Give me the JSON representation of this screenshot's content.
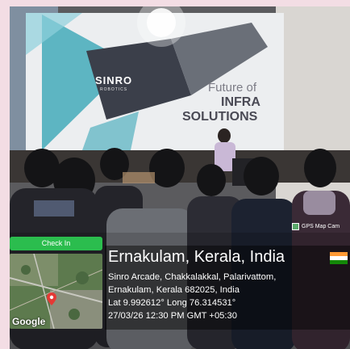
{
  "slide": {
    "brand": "SINRO",
    "brand_sub": "ROBOTICS",
    "line1": "Future of",
    "line2": "INFRA",
    "line3": "SOLUTIONS"
  },
  "gps_stamp": {
    "app_name": "GPS Map Cam",
    "check_in": "Check In",
    "map_logo": "Google",
    "city": "Ernakulam, Kerala, India",
    "address_line1": "Sinro Arcade, Chakkalakkal, Palarivattom,",
    "address_line2": "Ernakulam, Kerala 682025, India",
    "coordinates": "Lat 9.992612° Long 76.314531°",
    "datetime": "27/03/26 12:30 PM GMT +05:30",
    "flag_colors": [
      "#ff9933",
      "#ffffff",
      "#138808"
    ]
  },
  "colors": {
    "check_in_green": "#2bbd4e",
    "slide_teal": "#3aa6b7",
    "slide_dark": "#3b3f4a"
  }
}
